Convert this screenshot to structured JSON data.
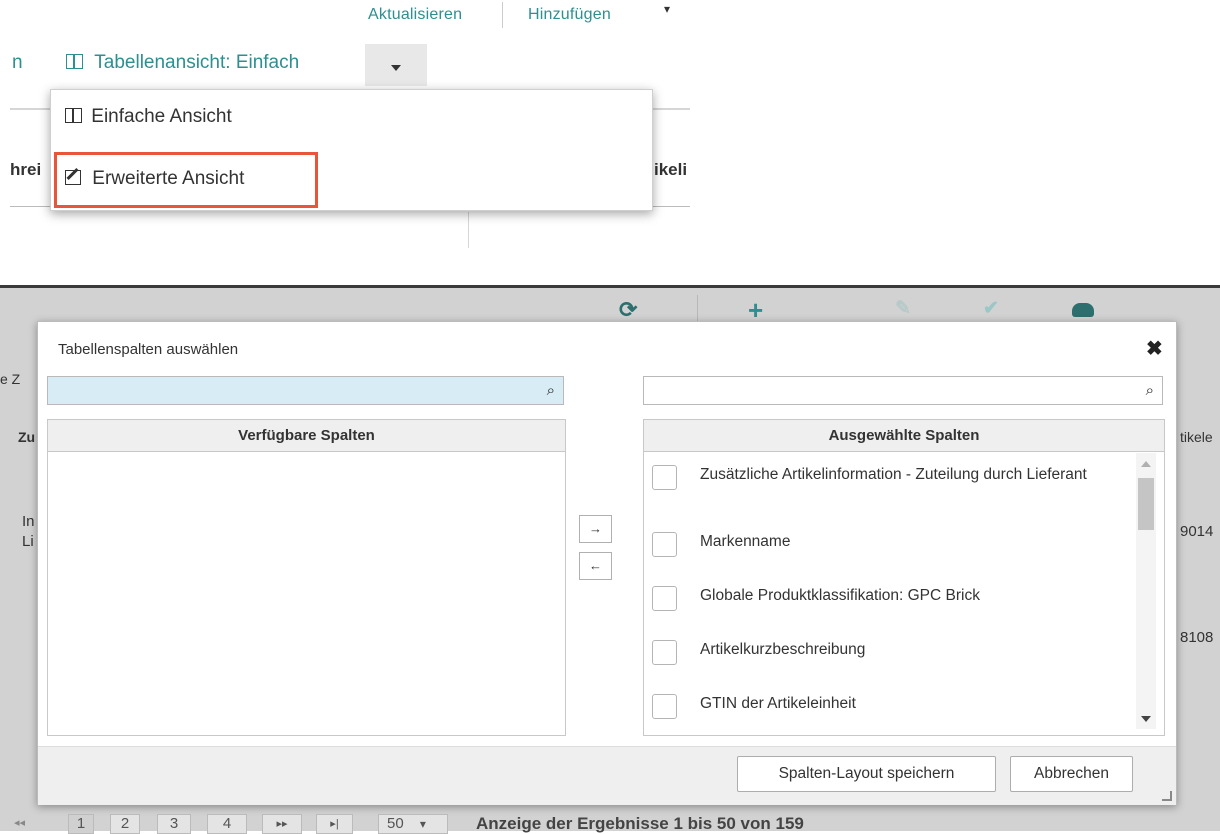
{
  "top_links": {
    "refresh": "Aktualisieren",
    "add": "Hinzufügen"
  },
  "view_bar": {
    "prev_fragment": "n",
    "view_label": "Tabellenansicht: Einfach"
  },
  "view_menu": {
    "items": [
      {
        "label": "Einfache Ansicht",
        "icon": "table-icon"
      },
      {
        "label": "Erweiterte Ansicht",
        "icon": "edit-icon"
      }
    ],
    "highlighted_index": 1
  },
  "bg_fragments": {
    "left_header": "hrei",
    "right_header": "ikeli"
  },
  "lower_bg": {
    "left_tab": "e Z",
    "left_col_header": "Zu",
    "left_row1": "In",
    "left_row2": "Li",
    "right_col_header": "tikele",
    "right_row1": "9014",
    "right_row2": "8108"
  },
  "dialog": {
    "title": "Tabellenspalten auswählen",
    "close_label": "✖",
    "left_search_value": "",
    "right_search_value": "",
    "available_header": "Verfügbare Spalten",
    "selected_header": "Ausgewählte Spalten",
    "move_right_label": "→",
    "move_left_label": "←",
    "selected_columns": [
      "Zusätzliche Artikelinformation - Zuteilung durch Lieferant",
      "Markenname",
      "Globale Produktklassifikation: GPC Brick",
      "Artikelkurzbeschreibung",
      "GTIN der Artikeleinheit"
    ],
    "save_button": "Spalten-Layout speichern",
    "cancel_button": "Abbrechen"
  },
  "pagination": {
    "pages": [
      "1",
      "2",
      "3",
      "4"
    ],
    "active_page": "1",
    "first": "◂◂",
    "next": "▸▸",
    "last": "▸|",
    "page_size": "50",
    "page_size_caret": "▾",
    "info": "Anzeige der Ergebnisse 1 bis 50 von 159"
  },
  "colors": {
    "accent": "#2d8f8f",
    "highlight": "#e8553a",
    "dialog_bg": "#ffffff",
    "overlay": "#d2d2d2"
  }
}
